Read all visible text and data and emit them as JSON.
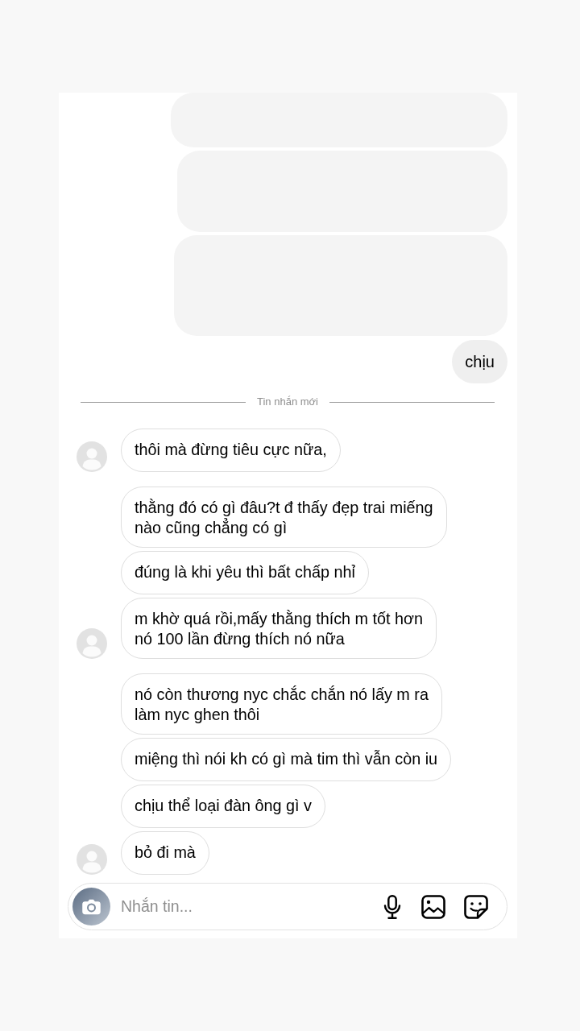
{
  "sent_messages": [
    {
      "kind": "blank"
    },
    {
      "kind": "blank"
    },
    {
      "kind": "blank"
    },
    {
      "kind": "text",
      "text": "chịu"
    }
  ],
  "divider": {
    "label": "Tin nhắn mới"
  },
  "received_groups": [
    {
      "messages": [
        {
          "lines": [
            "thôi mà đừng tiêu cực nữa,"
          ]
        }
      ]
    },
    {
      "messages": [
        {
          "lines": [
            "thằng đó có gì đâu?t đ thấy đẹp trai miếng",
            "nào cũng chẳng có gì"
          ]
        },
        {
          "lines": [
            "đúng là khi yêu thì bất chấp nhỉ"
          ]
        },
        {
          "lines": [
            "m khờ quá rồi,mấy thằng thích m tốt hơn",
            "nó 100 lần đừng thích nó nữa"
          ]
        }
      ]
    },
    {
      "messages": [
        {
          "lines": [
            "nó còn thương nyc chắc chắn nó lấy m ra",
            "làm nyc ghen thôi"
          ]
        },
        {
          "lines": [
            "miệng thì nói kh có gì mà tim thì vẫn còn iu"
          ]
        },
        {
          "lines": [
            "chịu thể loại đàn ông gì v"
          ]
        },
        {
          "lines": [
            "bỏ đi mà"
          ]
        }
      ]
    }
  ],
  "composer": {
    "placeholder": "Nhắn tin..."
  }
}
